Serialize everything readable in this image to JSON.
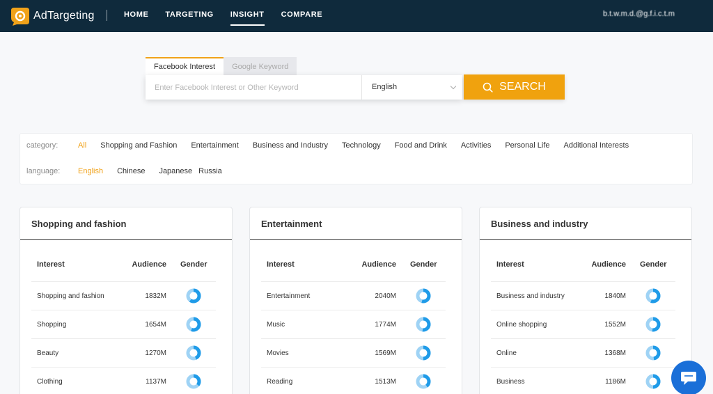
{
  "brand": {
    "name": "AdTargeting"
  },
  "nav": {
    "items": [
      "HOME",
      "TARGETING",
      "INSIGHT",
      "COMPARE"
    ],
    "active_index": 2
  },
  "user": {
    "email": "b.t.w.m.d.@g.f.i.c.t.m"
  },
  "search": {
    "tabs": [
      "Facebook Interest",
      "Google Keyword"
    ],
    "active_tab": 0,
    "placeholder": "Enter Facebook Interest or Other Keyword",
    "value": "",
    "language": "English",
    "button_label": "SEARCH"
  },
  "filters": {
    "category_label": "category:",
    "categories": [
      "All",
      "Shopping and Fashion",
      "Entertainment",
      "Business and Industry",
      "Technology",
      "Food and Drink",
      "Activities",
      "Personal Life",
      "Additional Interests"
    ],
    "active_category": 0,
    "language_label": "language:",
    "languages": [
      "English",
      "Chinese",
      "Japanese",
      "Russia"
    ],
    "active_language": 0
  },
  "table_headers": {
    "interest": "Interest",
    "audience": "Audience",
    "gender": "Gender"
  },
  "cards": [
    {
      "title": "Shopping and fashion",
      "rows": [
        {
          "interest": "Shopping and fashion",
          "audience": "1832M"
        },
        {
          "interest": "Shopping",
          "audience": "1654M"
        },
        {
          "interest": "Beauty",
          "audience": "1270M"
        },
        {
          "interest": "Clothing",
          "audience": "1137M"
        }
      ]
    },
    {
      "title": "Entertainment",
      "rows": [
        {
          "interest": "Entertainment",
          "audience": "2040M"
        },
        {
          "interest": "Music",
          "audience": "1774M"
        },
        {
          "interest": "Movies",
          "audience": "1569M"
        },
        {
          "interest": "Reading",
          "audience": "1513M"
        }
      ]
    },
    {
      "title": "Business and industry",
      "rows": [
        {
          "interest": "Business and industry",
          "audience": "1840M"
        },
        {
          "interest": "Online shopping",
          "audience": "1552M"
        },
        {
          "interest": "Online",
          "audience": "1368M"
        },
        {
          "interest": "Business",
          "audience": "1186M"
        }
      ]
    }
  ],
  "colors": {
    "accent": "#f0a20e",
    "header_bg": "#0f2a3c",
    "donut_primary": "#1f9be8",
    "donut_secondary": "#9fd3f5",
    "chat": "#1a6fd8"
  },
  "icons": {
    "search": "search-icon",
    "chat": "chat-icon",
    "chevron": "chevron-down-icon",
    "gender": "gender-donut-icon"
  }
}
